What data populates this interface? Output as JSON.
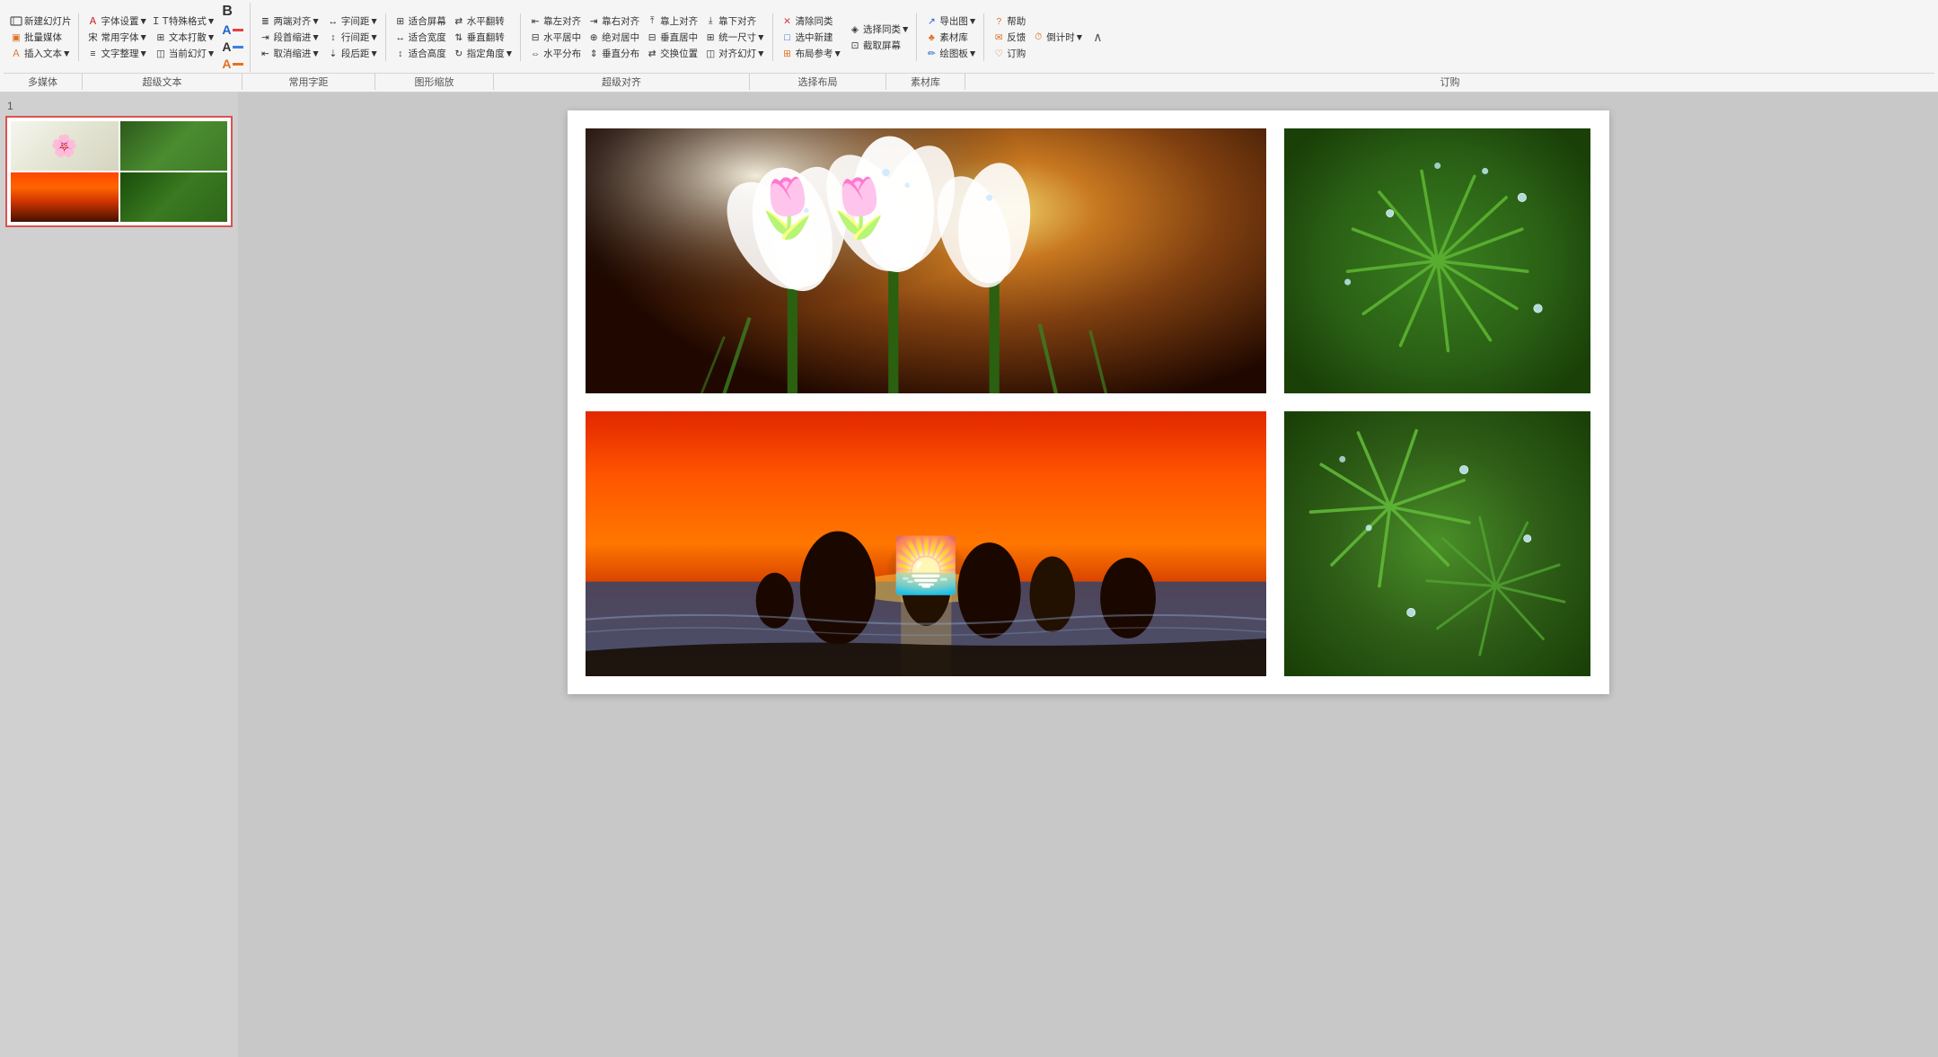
{
  "toolbar": {
    "row1": {
      "groups": [
        {
          "name": "多媒体",
          "items": [
            {
              "id": "new-slide",
              "label": "新建幻灯片",
              "icon": "slide-icon",
              "hasArrow": true
            },
            {
              "id": "batch-media",
              "label": "批量媒体",
              "icon": "media-icon",
              "hasArrow": true
            },
            {
              "id": "insert-text",
              "label": "插入文本▼",
              "icon": "text-icon",
              "hasArrow": true
            }
          ]
        },
        {
          "name": "超级文本",
          "items": [
            {
              "id": "font-set",
              "label": "字体设置▼",
              "icon": "font-icon",
              "hasArrow": true
            },
            {
              "id": "common-font",
              "label": "常用字体▼",
              "icon": "font2-icon",
              "hasArrow": true
            },
            {
              "id": "text-arrange",
              "label": "文字整理▼",
              "icon": "arrange-icon",
              "hasArrow": true
            },
            {
              "id": "special-format",
              "label": "特殊格式▼",
              "icon": "special-icon",
              "hasArrow": true
            },
            {
              "id": "text-punch",
              "label": "文本打散▼",
              "icon": "punch-icon",
              "hasArrow": true
            },
            {
              "id": "current-slide",
              "label": "当前幻灯▼",
              "icon": "current-icon",
              "hasArrow": true
            },
            {
              "id": "bold",
              "label": "B",
              "icon": "bold-icon"
            },
            {
              "id": "color-a1",
              "label": "A",
              "icon": "color-a1-icon"
            },
            {
              "id": "color-a2",
              "label": "A",
              "icon": "color-a2-icon"
            },
            {
              "id": "color-a3",
              "label": "A",
              "icon": "color-a3-icon"
            }
          ]
        },
        {
          "name": "常用字距",
          "items": [
            {
              "id": "align-both",
              "label": "两端对齐▼",
              "icon": "align-both-icon",
              "hasArrow": true
            },
            {
              "id": "para-indent",
              "label": "段首缩进▼",
              "icon": "indent-icon",
              "hasArrow": true
            },
            {
              "id": "cancel-indent",
              "label": "取消缩进▼",
              "icon": "cancel-indent-icon",
              "hasArrow": true
            },
            {
              "id": "char-space",
              "label": "字间距▼",
              "icon": "char-space-icon",
              "hasArrow": true
            },
            {
              "id": "line-space",
              "label": "行间距▼",
              "icon": "line-space-icon",
              "hasArrow": true
            },
            {
              "id": "para-after",
              "label": "段后距▼",
              "icon": "para-after-icon",
              "hasArrow": true
            }
          ]
        },
        {
          "name": "图形缩放",
          "items": [
            {
              "id": "fit-screen",
              "label": "适合屏幕",
              "icon": "fit-screen-icon"
            },
            {
              "id": "fit-width",
              "label": "适合宽度",
              "icon": "fit-width-icon"
            },
            {
              "id": "fit-height",
              "label": "适合高度",
              "icon": "fit-height-icon"
            },
            {
              "id": "h-flip",
              "label": "水平翻转",
              "icon": "h-flip-icon"
            },
            {
              "id": "v-flip",
              "label": "垂直翻转",
              "icon": "v-flip-icon"
            },
            {
              "id": "rotate-angle",
              "label": "指定角度▼",
              "icon": "rotate-icon",
              "hasArrow": true
            }
          ]
        },
        {
          "name": "超级对齐",
          "items": [
            {
              "id": "align-left",
              "label": "靠左对齐",
              "icon": "align-left-icon"
            },
            {
              "id": "align-right",
              "label": "靠右对齐",
              "icon": "align-right-icon"
            },
            {
              "id": "align-top",
              "label": "靠上对齐",
              "icon": "align-top-icon"
            },
            {
              "id": "align-bottom",
              "label": "靠下对齐",
              "icon": "align-bottom-icon"
            },
            {
              "id": "h-center",
              "label": "水平居中",
              "icon": "h-center-icon"
            },
            {
              "id": "abs-center",
              "label": "绝对居中",
              "icon": "abs-center-icon"
            },
            {
              "id": "v-center",
              "label": "垂直居中",
              "icon": "v-center-icon"
            },
            {
              "id": "unify-size",
              "label": "统一尺寸▼",
              "icon": "unify-icon",
              "hasArrow": true
            },
            {
              "id": "h-distribute",
              "label": "水平分布",
              "icon": "h-dist-icon"
            },
            {
              "id": "v-distribute",
              "label": "垂直分布",
              "icon": "v-dist-icon"
            },
            {
              "id": "swap-pos",
              "label": "交换位置",
              "icon": "swap-icon"
            },
            {
              "id": "align-slide",
              "label": "对齐幻灯▼",
              "icon": "align-slide-icon",
              "hasArrow": true
            }
          ]
        },
        {
          "name": "选择布局",
          "items": [
            {
              "id": "clear-same",
              "label": "清除同类",
              "icon": "clear-icon"
            },
            {
              "id": "select-new",
              "label": "选中新建",
              "icon": "select-new-icon"
            },
            {
              "id": "select-same",
              "label": "选择同类▼",
              "icon": "select-same-icon",
              "hasArrow": true
            },
            {
              "id": "screenshot",
              "label": "截取屏幕",
              "icon": "screenshot-icon"
            },
            {
              "id": "layout-ref",
              "label": "布局参考▼",
              "icon": "layout-icon",
              "hasArrow": true
            }
          ]
        },
        {
          "name": "素材库",
          "items": [
            {
              "id": "export-img",
              "label": "导出图▼",
              "icon": "export-icon",
              "hasArrow": true
            },
            {
              "id": "material",
              "label": "素材库",
              "icon": "material-icon"
            },
            {
              "id": "draw-board",
              "label": "绘图板▼",
              "icon": "draw-icon",
              "hasArrow": true
            }
          ]
        },
        {
          "name": "订购",
          "items": [
            {
              "id": "help",
              "label": "帮助",
              "icon": "help-icon"
            },
            {
              "id": "feedback",
              "label": "反馈",
              "icon": "feedback-icon"
            },
            {
              "id": "countdown",
              "label": "倒计时▼",
              "icon": "countdown-icon",
              "hasArrow": true
            },
            {
              "id": "subscribe",
              "label": "订购",
              "icon": "subscribe-icon"
            },
            {
              "id": "collapse",
              "label": "∧",
              "icon": "collapse-icon"
            }
          ]
        }
      ]
    }
  },
  "slide_panel": {
    "slide_number": "1"
  },
  "slide": {
    "images": [
      {
        "id": "flowers-main",
        "type": "flowers",
        "alt": "White flowers with rain drops"
      },
      {
        "id": "green-top",
        "type": "green-leaves",
        "alt": "Green leaves with water drops top"
      },
      {
        "id": "sunset",
        "type": "sunset",
        "alt": "Sunset over ocean rocks"
      },
      {
        "id": "green-bottom",
        "type": "green-leaves",
        "alt": "Green leaves with water drops bottom"
      }
    ]
  }
}
